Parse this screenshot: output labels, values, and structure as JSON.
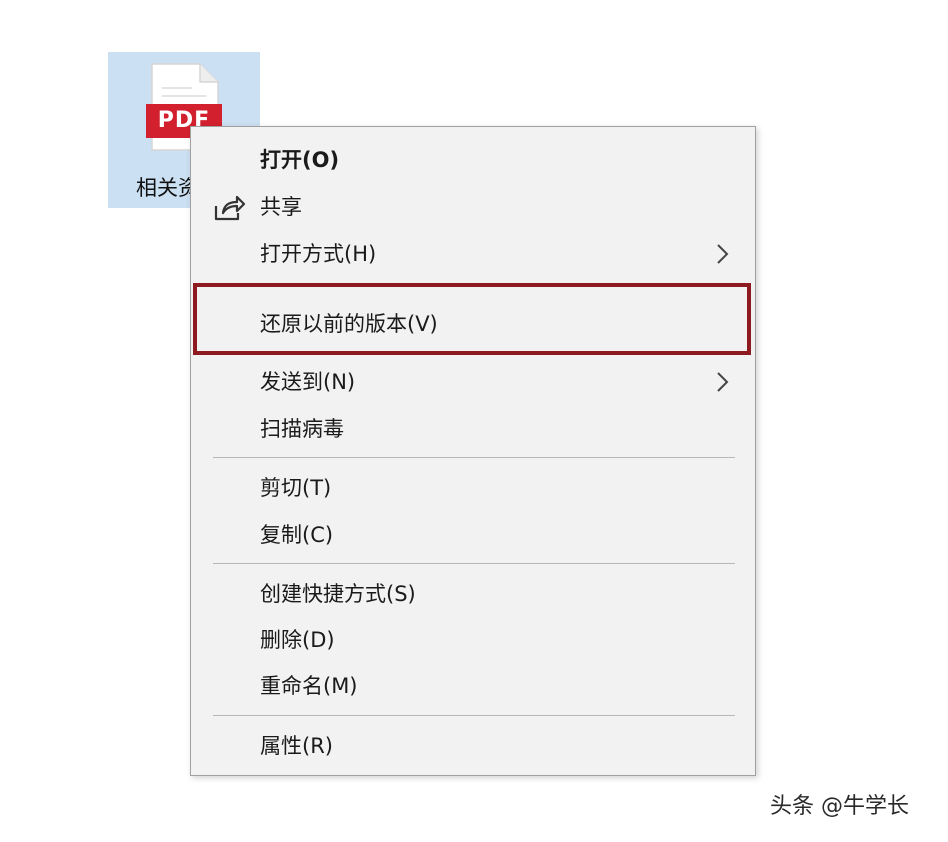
{
  "desktop": {
    "file": {
      "badge_text": "PDF",
      "name": "相关资",
      "selection_color": "#cce0f3",
      "badge_color": "#d3202e"
    }
  },
  "context_menu": {
    "items": [
      {
        "label": "打开(O)",
        "bold": true
      },
      {
        "label": "共享",
        "icon": "share-icon"
      },
      {
        "label": "打开方式(H)",
        "submenu": true
      },
      {
        "label": "还原以前的版本(V)",
        "highlighted": true
      },
      {
        "label": "发送到(N)",
        "submenu": true
      },
      {
        "label": "扫描病毒"
      },
      {
        "label": "剪切(T)"
      },
      {
        "label": "复制(C)"
      },
      {
        "label": "创建快捷方式(S)"
      },
      {
        "label": "删除(D)"
      },
      {
        "label": "重命名(M)"
      },
      {
        "label": "属性(R)"
      }
    ],
    "highlight_color": "#8c1a1f"
  },
  "watermark": {
    "text": "头条 @牛学长"
  }
}
